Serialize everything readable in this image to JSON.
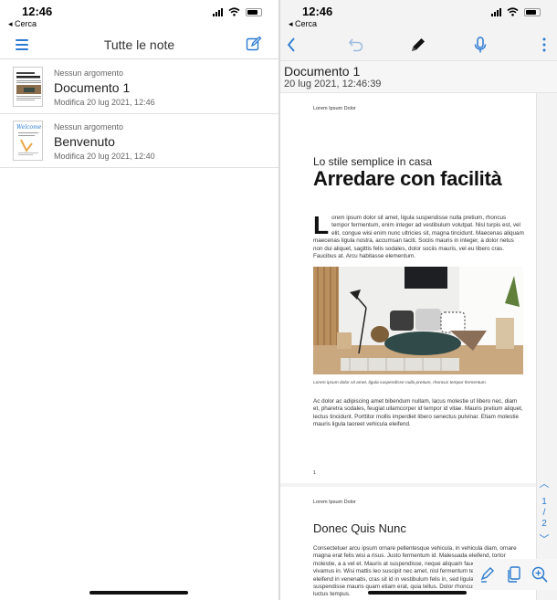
{
  "left": {
    "status": {
      "time": "12:46",
      "back": "◂ Cerca"
    },
    "header": {
      "title": "Tutte le note"
    },
    "notes": [
      {
        "topic": "Nessun argomento",
        "title": "Documento 1",
        "modified": "Modifica 20 lug 2021, 12:46"
      },
      {
        "topic": "Nessun argomento",
        "title": "Benvenuto",
        "modified": "Modifica 20 lug 2021, 12:40",
        "thumb_text": "Welcome"
      }
    ]
  },
  "right": {
    "status": {
      "time": "12:46",
      "back": "◂ Cerca"
    },
    "doc": {
      "title": "Documento 1",
      "date": "20 lug 2021, 12:46:39"
    },
    "page1": {
      "header": "Lorem Ipsum Dolor",
      "subtitle": "Lo stile semplice in casa",
      "title": "Arredare con facilità",
      "dropcap": "L",
      "para1": "orem ipsum dolor sit amet, ligula suspendisse nulla pretium, rhoncus tempor fermentum, enim integer ad vestibulum volutpat. Nisl turpis est, vel elit, congue wisi enim nunc ultricies sit, magna tincidunt. Maecenas aliquam maecenas ligula nostra, accumsan taciti. Sociis mauris in integer, a dolor netus non dui aliquet, sagittis felis sodales, dolor sociis mauris, vel eu libero cras. Faucibus at. Arcu habitasse elementum.",
      "caption": "Lorem ipsum dolor sit amet, ligula suspendisse nulla pretium, rhoncus tempor fermentum.",
      "para2": "Ac dolor ac adipiscing amet bibendum nullam, lacus molestie ut libero nec, diam et, pharetra sodales, feugiat ullamcorper id tempor id vitae. Mauris pretium aliquet, lectus tincidunt. Porttitor mollis imperdiet libero senectus pulvinar. Etiam molestie mauris ligula laoreet vehicula eleifend.",
      "page_number": "1"
    },
    "page2": {
      "header": "Lorem Ipsum Dolor",
      "title": "Donec Quis Nunc",
      "para": "Consectetuer arcu ipsum ornare pellentesque vehicula, in vehicula diam, ornare magna erat felis wisi a risus. Justo fermentum id. Malesuada eleifend, tortor molestie, a a vel et. Mauris at suspendisse, neque aliquam faucibus adipiscing, vivamus in. Wisi mattis leo suscipit nec amet, nisl fermentum tempor ac a, augue in eleifend in venenatis, cras sit id in vestibulum felis in, sed ligula. In sodales suspendisse mauris quam etiam erat, quia tellus. Dolor rhoncus diam orci, porta luctus tempus."
    },
    "pager": {
      "current": "1",
      "sep": "/",
      "total": "2"
    },
    "colors": {
      "accent": "#2a7ad1"
    }
  }
}
